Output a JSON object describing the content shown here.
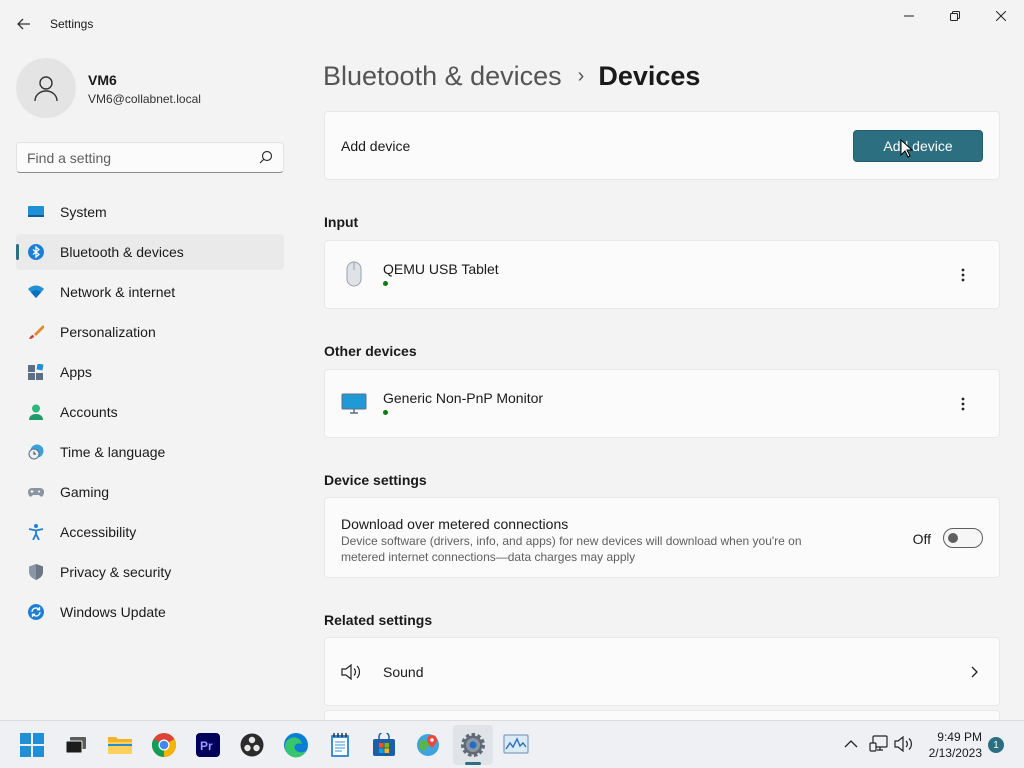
{
  "window": {
    "title": "Settings",
    "controls": {
      "minimize": "minimize-icon",
      "maximize": "restore-icon",
      "close": "close-icon"
    }
  },
  "profile": {
    "name": "VM6",
    "email": "VM6@collabnet.local"
  },
  "search": {
    "placeholder": "Find a setting",
    "value": ""
  },
  "sidebar": {
    "items": [
      {
        "label": "System",
        "icon": "system-icon",
        "active": false
      },
      {
        "label": "Bluetooth & devices",
        "icon": "bluetooth-icon",
        "active": true
      },
      {
        "label": "Network & internet",
        "icon": "wifi-icon",
        "active": false
      },
      {
        "label": "Personalization",
        "icon": "brush-icon",
        "active": false
      },
      {
        "label": "Apps",
        "icon": "apps-icon",
        "active": false
      },
      {
        "label": "Accounts",
        "icon": "accounts-icon",
        "active": false
      },
      {
        "label": "Time & language",
        "icon": "clock-globe-icon",
        "active": false
      },
      {
        "label": "Gaming",
        "icon": "gamepad-icon",
        "active": false
      },
      {
        "label": "Accessibility",
        "icon": "accessibility-icon",
        "active": false
      },
      {
        "label": "Privacy & security",
        "icon": "shield-icon",
        "active": false
      },
      {
        "label": "Windows Update",
        "icon": "update-icon",
        "active": false
      }
    ]
  },
  "breadcrumb": {
    "parent": "Bluetooth & devices",
    "separator": "›",
    "current": "Devices"
  },
  "add_device": {
    "label": "Add device",
    "button": "Add device"
  },
  "sections": {
    "input": {
      "title": "Input",
      "devices": [
        {
          "name": "QEMU USB Tablet",
          "icon": "mouse-icon",
          "status": "connected"
        }
      ]
    },
    "other": {
      "title": "Other devices",
      "devices": [
        {
          "name": "Generic Non-PnP Monitor",
          "icon": "monitor-icon",
          "status": "connected"
        }
      ]
    },
    "device_settings": {
      "title": "Device settings",
      "metered": {
        "title": "Download over metered connections",
        "description": "Device software (drivers, info, and apps) for new devices will download when you're on metered internet connections—data charges may apply",
        "state_label": "Off",
        "on": false
      }
    },
    "related": {
      "title": "Related settings",
      "items": [
        {
          "label": "Sound",
          "icon": "speaker-icon"
        }
      ]
    }
  },
  "taskbar": {
    "apps": [
      "start-icon",
      "task-view-icon",
      "file-explorer-icon",
      "chrome-icon",
      "premiere-icon",
      "obs-icon",
      "edge-icon",
      "notepad-icon",
      "store-icon",
      "maps-icon",
      "settings-icon",
      "performance-monitor-icon"
    ],
    "active_app": "settings-icon",
    "tray": [
      "chevron-up-icon",
      "network-icon",
      "volume-icon"
    ],
    "time": "9:49 PM",
    "date": "2/13/2023",
    "notifications": "1"
  },
  "colors": {
    "accent": "#2b6f80",
    "status_connected": "#0f7b0f",
    "background": "#f3f3f3",
    "card": "#fbfbfb"
  }
}
